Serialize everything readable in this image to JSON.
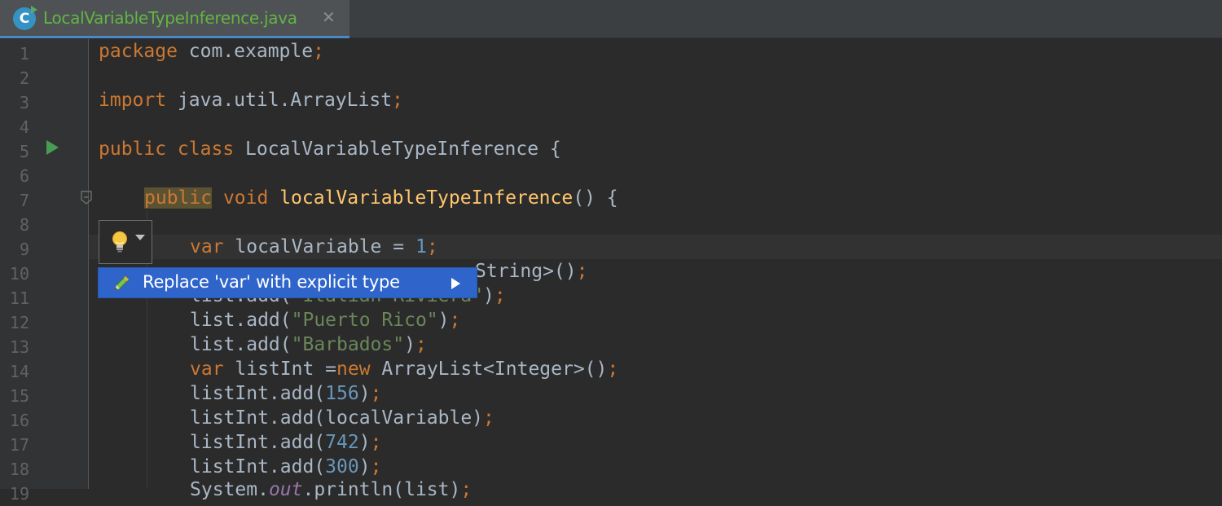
{
  "tab": {
    "file_name": "LocalVariableTypeInference.java",
    "icon": "class-c-icon",
    "close_glyph": "✕"
  },
  "gutter": {
    "line_numbers": [
      "1",
      "2",
      "3",
      "4",
      "5",
      "6",
      "7",
      "8",
      "9",
      "10",
      "11",
      "12",
      "13",
      "14",
      "15",
      "16",
      "17",
      "18",
      "19"
    ],
    "run_icon": "run-triangle-icon",
    "fold_icon": "fold-marker-icon"
  },
  "code": {
    "l1_kw": "package",
    "l1_rest": " com.example",
    "l1_semi": ";",
    "l3_kw": "import",
    "l3_rest": " java.util.ArrayList",
    "l3_semi": ";",
    "l5_kw": "public class",
    "l5_rest": " LocalVariableTypeInference {",
    "l7_kw1": "public",
    "l7_kw2": " void ",
    "l7_fn": "localVariableTypeInference",
    "l7_rest": "() {",
    "l9_kw": "var",
    "l9_rest": " localVariable = ",
    "l9_num": "1",
    "l9_semi": ";",
    "l10_partial": "String>()",
    "l10_semi": ";",
    "l11_partial1": "list.add(",
    "l11_partial_str": "\"Italian Riviera\"",
    "l11_partial2": ")",
    "l11_semi": ";",
    "l12_a": "list.add(",
    "l12_str": "\"Puerto Rico\"",
    "l12_b": ")",
    "l12_semi": ";",
    "l13_a": "list.add(",
    "l13_str": "\"Barbados\"",
    "l13_b": ")",
    "l13_semi": ";",
    "l14_kw1": "var",
    "l14_a": " listInt =",
    "l14_kw2": "new",
    "l14_b": " ArrayList<Integer>()",
    "l14_semi": ";",
    "l15_a": "listInt.add(",
    "l15_num": "156",
    "l15_b": ")",
    "l15_semi": ";",
    "l16_a": "listInt.add(localVariable)",
    "l16_semi": ";",
    "l17_a": "listInt.add(",
    "l17_num": "742",
    "l17_b": ")",
    "l17_semi": ";",
    "l18_a": "listInt.add(",
    "l18_num": "300",
    "l18_b": ")",
    "l18_semi": ";",
    "l19_a": "System.",
    "l19_fld": "out",
    "l19_b": ".println(list)",
    "l19_semi": ";"
  },
  "intention": {
    "bulb_icon": "lightbulb-icon",
    "action_label": "Replace 'var' with explicit type",
    "action_icon": "pencil-icon",
    "submenu_icon": "submenu-arrow-icon"
  },
  "colors": {
    "editor_bg": "#2b2b2b",
    "keyword": "#cc7832",
    "string": "#6a8759",
    "number": "#6897bb",
    "method": "#ffc66d",
    "popup_bg": "#2f65ca",
    "tab_text": "#62b543"
  }
}
